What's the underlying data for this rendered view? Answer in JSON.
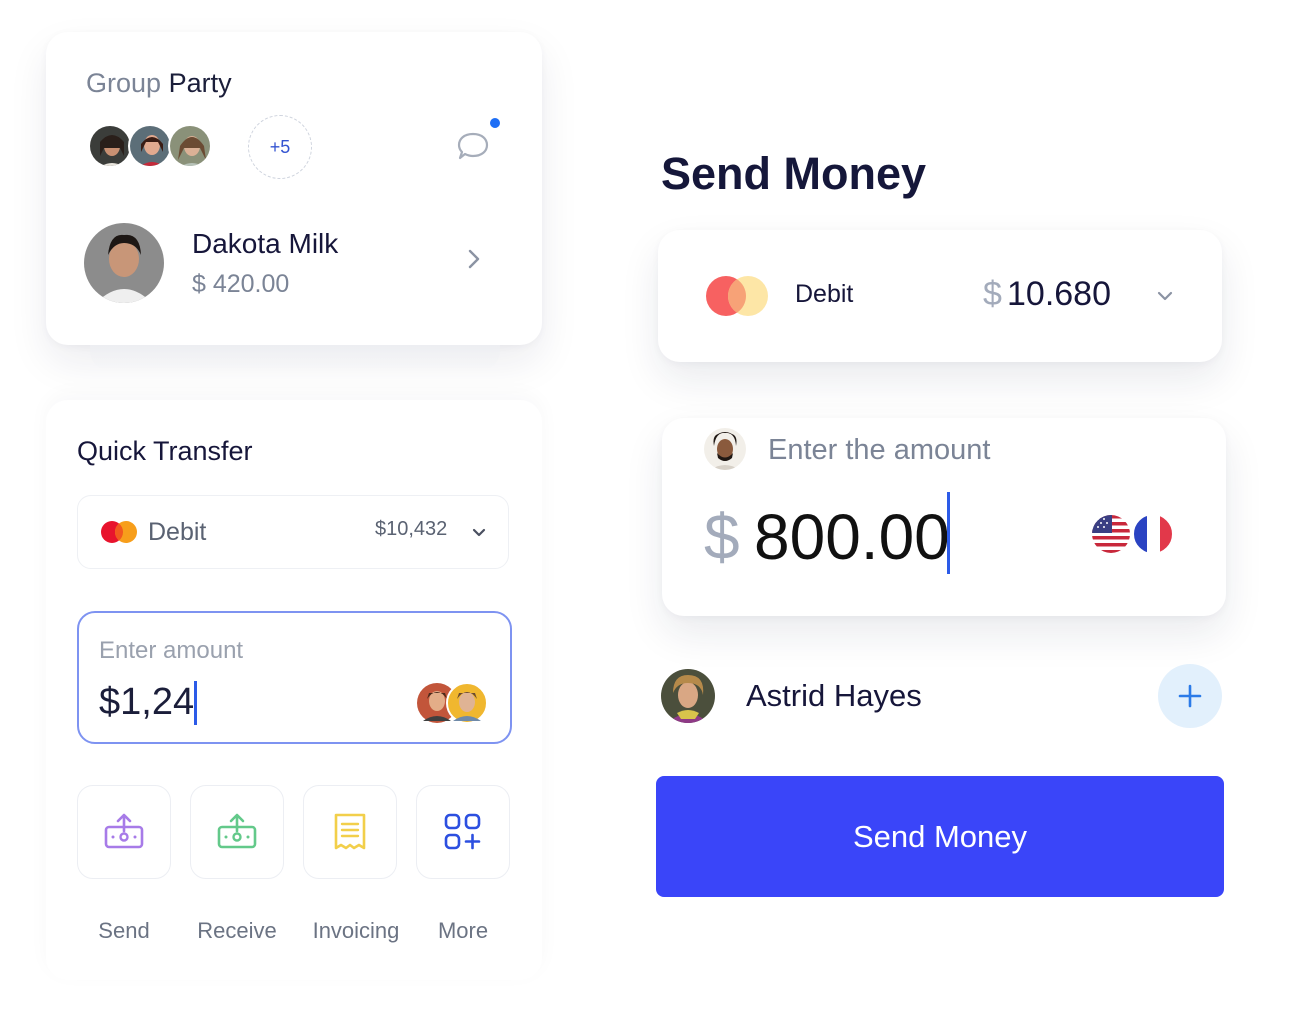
{
  "group": {
    "title_part1": "Group",
    "title_part2": "Party",
    "more_count": "+5",
    "person_name": "Dakota Milk",
    "person_amount": "$ 420.00"
  },
  "quick_transfer": {
    "title": "Quick Transfer",
    "card_label": "Debit",
    "card_balance": "$10,432",
    "amount_placeholder": "Enter amount",
    "amount_value": "$1,24",
    "actions": [
      {
        "label": "Send",
        "icon": "send-money-icon"
      },
      {
        "label": "Receive",
        "icon": "receive-money-icon"
      },
      {
        "label": "Invoicing",
        "icon": "invoice-receipt-icon"
      },
      {
        "label": "More",
        "icon": "more-apps-icon"
      }
    ]
  },
  "send_money": {
    "title": "Send Money",
    "card_label": "Debit",
    "card_currency": "$",
    "card_balance": "10.680",
    "amount_placeholder": "Enter the amount",
    "amount_currency": "$",
    "amount_value": "800.00",
    "recipient_name": "Astrid Hayes",
    "button_label": "Send Money"
  },
  "colors": {
    "primary_button": "#3a45f9",
    "accent_blue": "#3454d1",
    "send_icon": "#a77be8",
    "receive_icon": "#63c98a",
    "invoice_icon": "#f2cf4a",
    "more_icon": "#2c4fe0"
  }
}
